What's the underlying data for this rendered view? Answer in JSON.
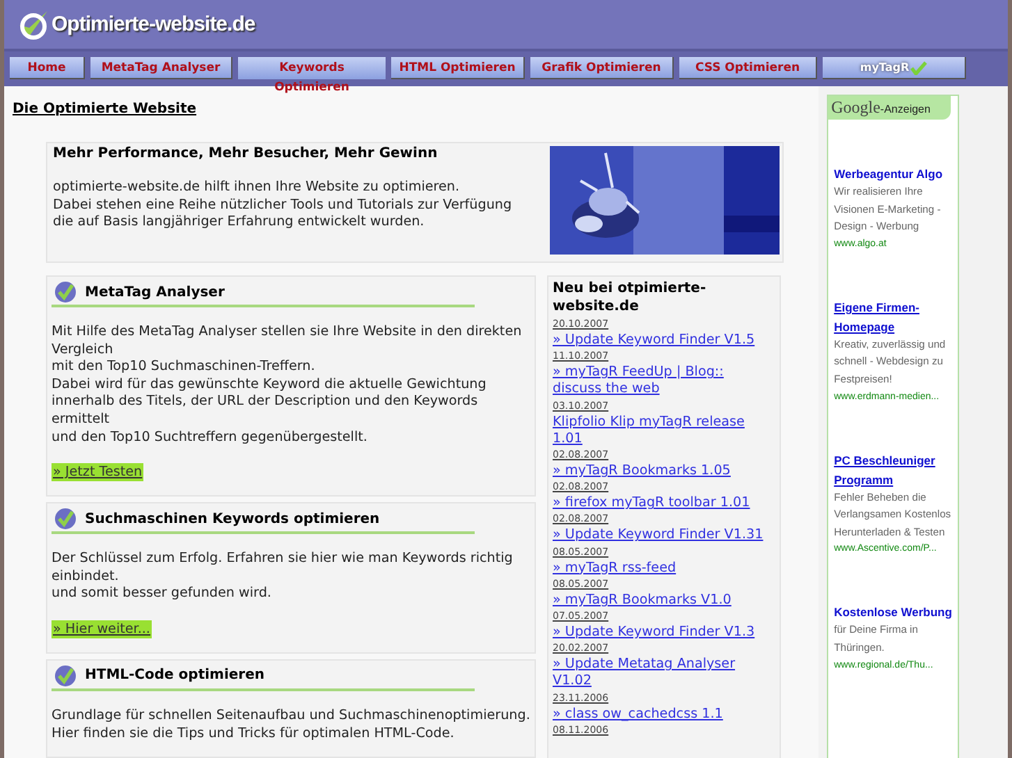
{
  "header": {
    "logo": "Optimierte-website.de"
  },
  "nav": [
    {
      "label": "Home",
      "kind": "text"
    },
    {
      "label": "MetaTag Analyser",
      "kind": "text"
    },
    {
      "label": "Keywords Optimieren",
      "kind": "text"
    },
    {
      "label": "HTML Optimieren",
      "kind": "text"
    },
    {
      "label": "Grafik Optimieren",
      "kind": "text"
    },
    {
      "label": "CSS Optimieren",
      "kind": "text"
    },
    {
      "label": "myTagR",
      "kind": "logo"
    }
  ],
  "page_title": "Die Optimierte Website",
  "intro": {
    "heading": "Mehr Performance, Mehr Besucher, Mehr Gewinn",
    "lines": [
      "optimierte-website.de hilft ihnen Ihre Website zu optimieren.",
      "Dabei stehen eine Reihe nützlicher Tools und Tutorials zur Verfügung",
      "die auf Basis langjähriger Erfahrung entwickelt wurden."
    ],
    "image": {
      "kind": "picture"
    }
  },
  "sections": [
    {
      "title": "MetaTag Analyser",
      "lines": [
        "Mit Hilfe des MetaTag Analyser stellen sie Ihre Website in den direkten Vergleich",
        "mit den Top10 Suchmaschinen-Treffern.",
        "Dabei wird für das gewünschte Keyword die aktuelle Gewichtung innerhalb des Titels, der URL der Description und den Keywords ermittelt",
        "und den Top10 Suchtreffern gegenübergestellt."
      ],
      "link": "» Jetzt Testen"
    },
    {
      "title": "Suchmaschinen Keywords optimieren",
      "lines": [
        "Der Schlüssel zum Erfolg. Erfahren sie hier wie man Keywords richtig einbindet.",
        "und somit besser gefunden wird."
      ],
      "link": "» Hier weiter..."
    },
    {
      "title": "HTML-Code optimieren",
      "lines": [
        "Grundlage für schnellen Seitenaufbau und Suchmaschinenoptimierung.",
        "Hier finden sie die Tips und Tricks für optimalen HTML-Code."
      ]
    }
  ],
  "news": {
    "title": "Neu bei otpimierte-website.de",
    "items": [
      {
        "date": "20.10.2007",
        "link": "» Update Keyword Finder V1.5"
      },
      {
        "date": "11.10.2007",
        "link": "» myTagR FeedUp | Blog:: discuss the web"
      },
      {
        "date": "03.10.2007",
        "link": "Klipfolio Klip myTagR release 1.01"
      },
      {
        "date": "02.08.2007",
        "link": "» myTagR Bookmarks 1.05"
      },
      {
        "date": "02.08.2007",
        "link": "» firefox myTagR toolbar 1.01"
      },
      {
        "date": "02.08.2007",
        "link": "» Update Keyword Finder V1.31"
      },
      {
        "date": "08.05.2007",
        "link": "» myTagR rss-feed"
      },
      {
        "date": "08.05.2007",
        "link": "» myTagR Bookmarks V1.0"
      },
      {
        "date": "07.05.2007",
        "link": "» Update Keyword Finder V1.3"
      },
      {
        "date": "20.02.2007",
        "link": "» Update Metatag Analyser V1.02"
      },
      {
        "date": "23.11.2006",
        "link": "» class ow_cachedcss 1.1"
      },
      {
        "date": "08.11.2006"
      }
    ]
  },
  "ads": {
    "label_brand": "Google",
    "label": "-Anzeigen",
    "items": [
      {
        "title": "Werbeagentur Algo",
        "text": "Wir realisieren Ihre Visionen E-Marketing - Design - Werbung",
        "url": "www.algo.at"
      },
      {
        "title": "Eigene Firmen-Homepage",
        "text": "Kreativ, zuverlässig und schnell - Webdesign zu Festpreisen!",
        "url": "www.erdmann-medien..."
      },
      {
        "title": "PC Beschleuniger Programm",
        "text": "Fehler Beheben die Verlangsamen Kostenlos Herunterladen & Testen",
        "url": "www.Ascentive.com/P..."
      },
      {
        "title": "Kostenlose Werbung",
        "text": "für Deine Firma in Thüringen.",
        "url": "www.regional.de/Thu..."
      }
    ]
  }
}
